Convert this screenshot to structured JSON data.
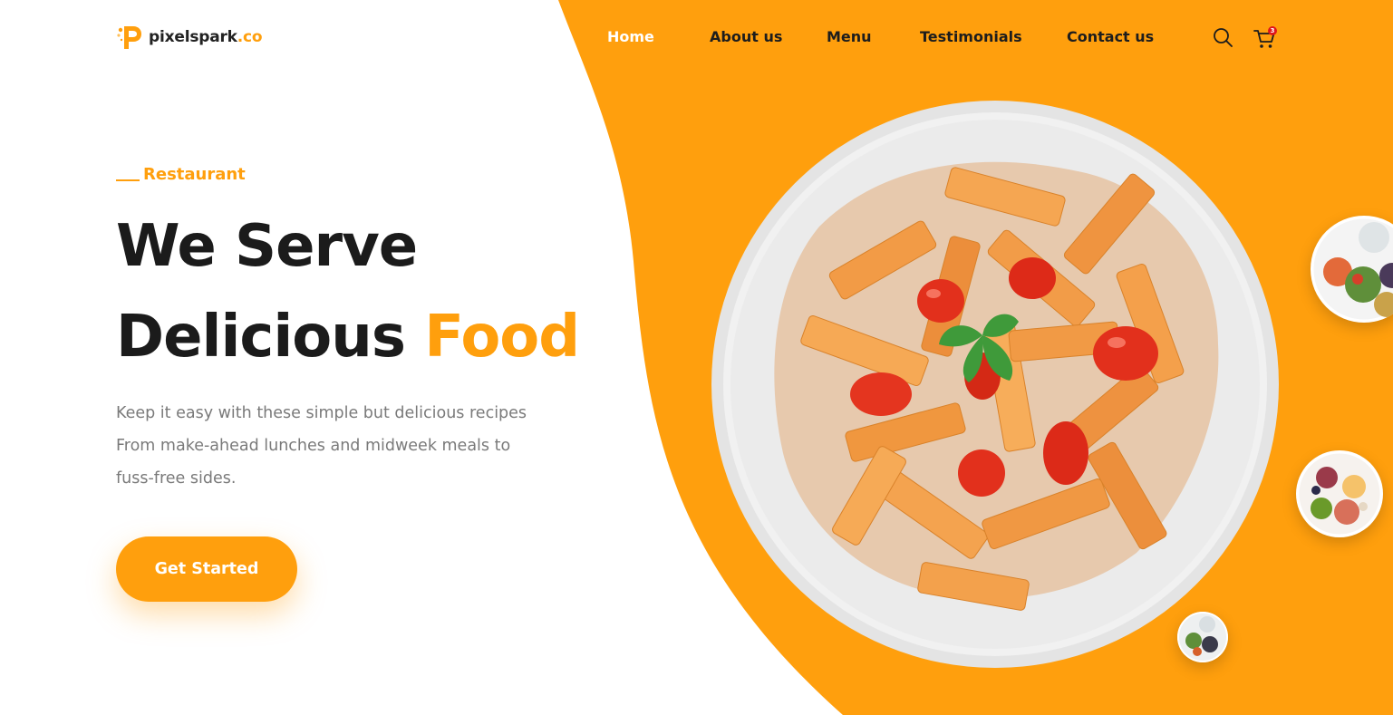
{
  "brand": {
    "name": "pixelspark",
    "tld": ".co",
    "logo_icon": "letter-p-logo"
  },
  "nav": {
    "items": [
      {
        "label": "Home",
        "active": true
      },
      {
        "label": "About us",
        "active": false
      },
      {
        "label": "Menu",
        "active": false
      },
      {
        "label": "Testimonials",
        "active": false
      },
      {
        "label": "Contact us",
        "active": false
      }
    ]
  },
  "header_icons": {
    "search": "search-icon",
    "cart": "shopping-cart-icon",
    "cart_count": "3"
  },
  "hero": {
    "eyebrow": "Restaurant",
    "headline_line1": "We Serve",
    "headline_line2_main": "Delicious",
    "headline_line2_accent": "Food",
    "description_line1": "Keep it easy with these simple but delicious recipes",
    "description_line2": "From make-ahead lunches and midweek meals to",
    "description_line3": "fuss-free sides.",
    "cta_label": "Get Started"
  },
  "images": {
    "main": "plate-of-penne-pasta-with-tomatoes",
    "thumbnails": [
      "salad-bowl-thumbnail",
      "fruit-plate-thumbnail",
      "mixed-dishes-thumbnail"
    ]
  },
  "colors": {
    "accent": "#ff9f0d",
    "heading": "#1b1b1b",
    "body_text": "#7a7a7a",
    "badge": "#e0161b"
  }
}
